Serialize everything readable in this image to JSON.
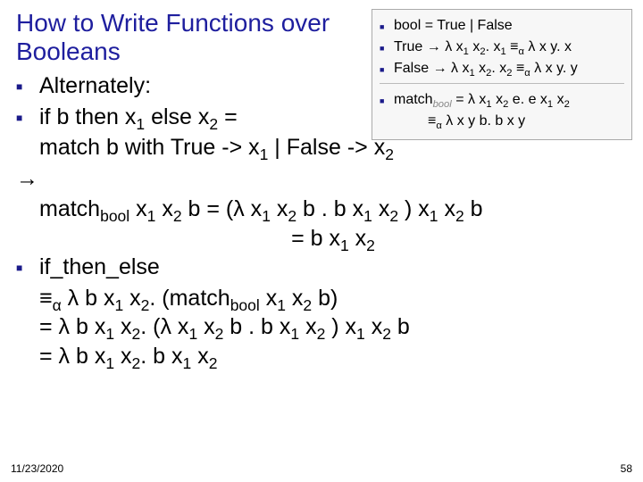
{
  "title": "How to Write Functions over Booleans",
  "bullets": {
    "alt": "Alternately:",
    "ifthen_a": "if b then x",
    "ifthen_b": " else x",
    "ifthen_c": "  =",
    "match_a": "match b with True  -> x",
    "match_b": " | False -> x",
    "arrow": "→",
    "mb_a": "match",
    "mb_sub": "bool",
    "mb_b": " x",
    "mb_c": " x",
    "mb_d": " b = (λ x",
    "mb_e": " x",
    "mb_f": " b . b x",
    "mb_g": " x",
    "mb_h": " ) x",
    "mb_i": " x",
    "mb_j": " b",
    "mb2_a": "= b x",
    "mb2_b": " x",
    "ite": "if_then_else",
    "eqv": "≡",
    "eqv_sub": "α",
    "l1_a": " λ b x",
    "l1_b": " x",
    "l1_c": ". (match",
    "l1_d": " x",
    "l1_e": " x",
    "l1_f": " b)",
    "l2_a": "=  λ b x",
    "l2_b": " x",
    "l2_c": ". (λ x",
    "l2_d": " x",
    "l2_e": " b . b x",
    "l2_f": " x",
    "l2_g": " ) x",
    "l2_h": " x",
    "l2_i": " b",
    "l3_a": "=  λ b x",
    "l3_b": " x",
    "l3_c": ". b x",
    "l3_d": " x"
  },
  "subs": {
    "one": "1",
    "two": "2"
  },
  "inset": {
    "r1": "bool = True | False",
    "r2_a": "True → λ x",
    "r2_b": " x",
    "r2_c": ". x",
    "r2_eq": "   ≡",
    "r2_d": "   λ x y. x",
    "r3_a": "False → λ x",
    "r3_b": " x",
    "r3_c": ". x",
    "r3_eq": "  ≡",
    "r3_d": "   λ x y. y",
    "r4_a": "match",
    "r4_b": "= λ x",
    "r4_c": " x",
    "r4_d": " e. e x",
    "r4_e": " x",
    "r5_a": "≡",
    "r5_b": "   λ x y b. b x y"
  },
  "footer": {
    "date": "11/23/2020",
    "page": "58"
  }
}
